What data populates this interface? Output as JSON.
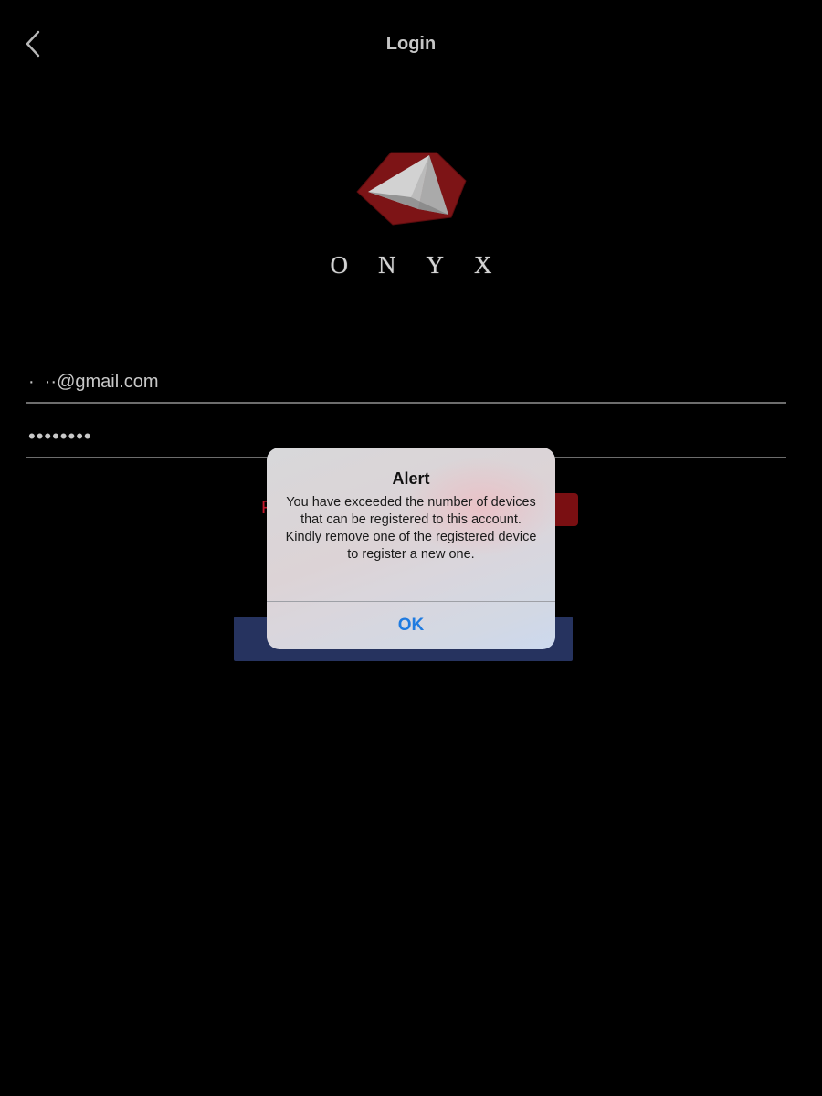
{
  "nav": {
    "title": "Login",
    "back_icon": "chevron-left-icon"
  },
  "brand": {
    "wordmark": "ONYX",
    "logo_icon": "onyx-gem-logo",
    "logo_colors": {
      "red": "#7d1416",
      "silver": "#bdbdbd"
    }
  },
  "form": {
    "email_value": "·  ··@gmail.com",
    "password_value": "••••••••",
    "forgot_link_fragment": "F"
  },
  "alert": {
    "title": "Alert",
    "message": "You have exceeded the number of devices that can be registered to this account. Kindly remove one of the registered device to register a new one.",
    "ok_label": "OK"
  },
  "colors": {
    "background": "#000000",
    "accent_red": "#c3182b",
    "login_button": "#26335f",
    "alert_button_text": "#1f7be0"
  }
}
